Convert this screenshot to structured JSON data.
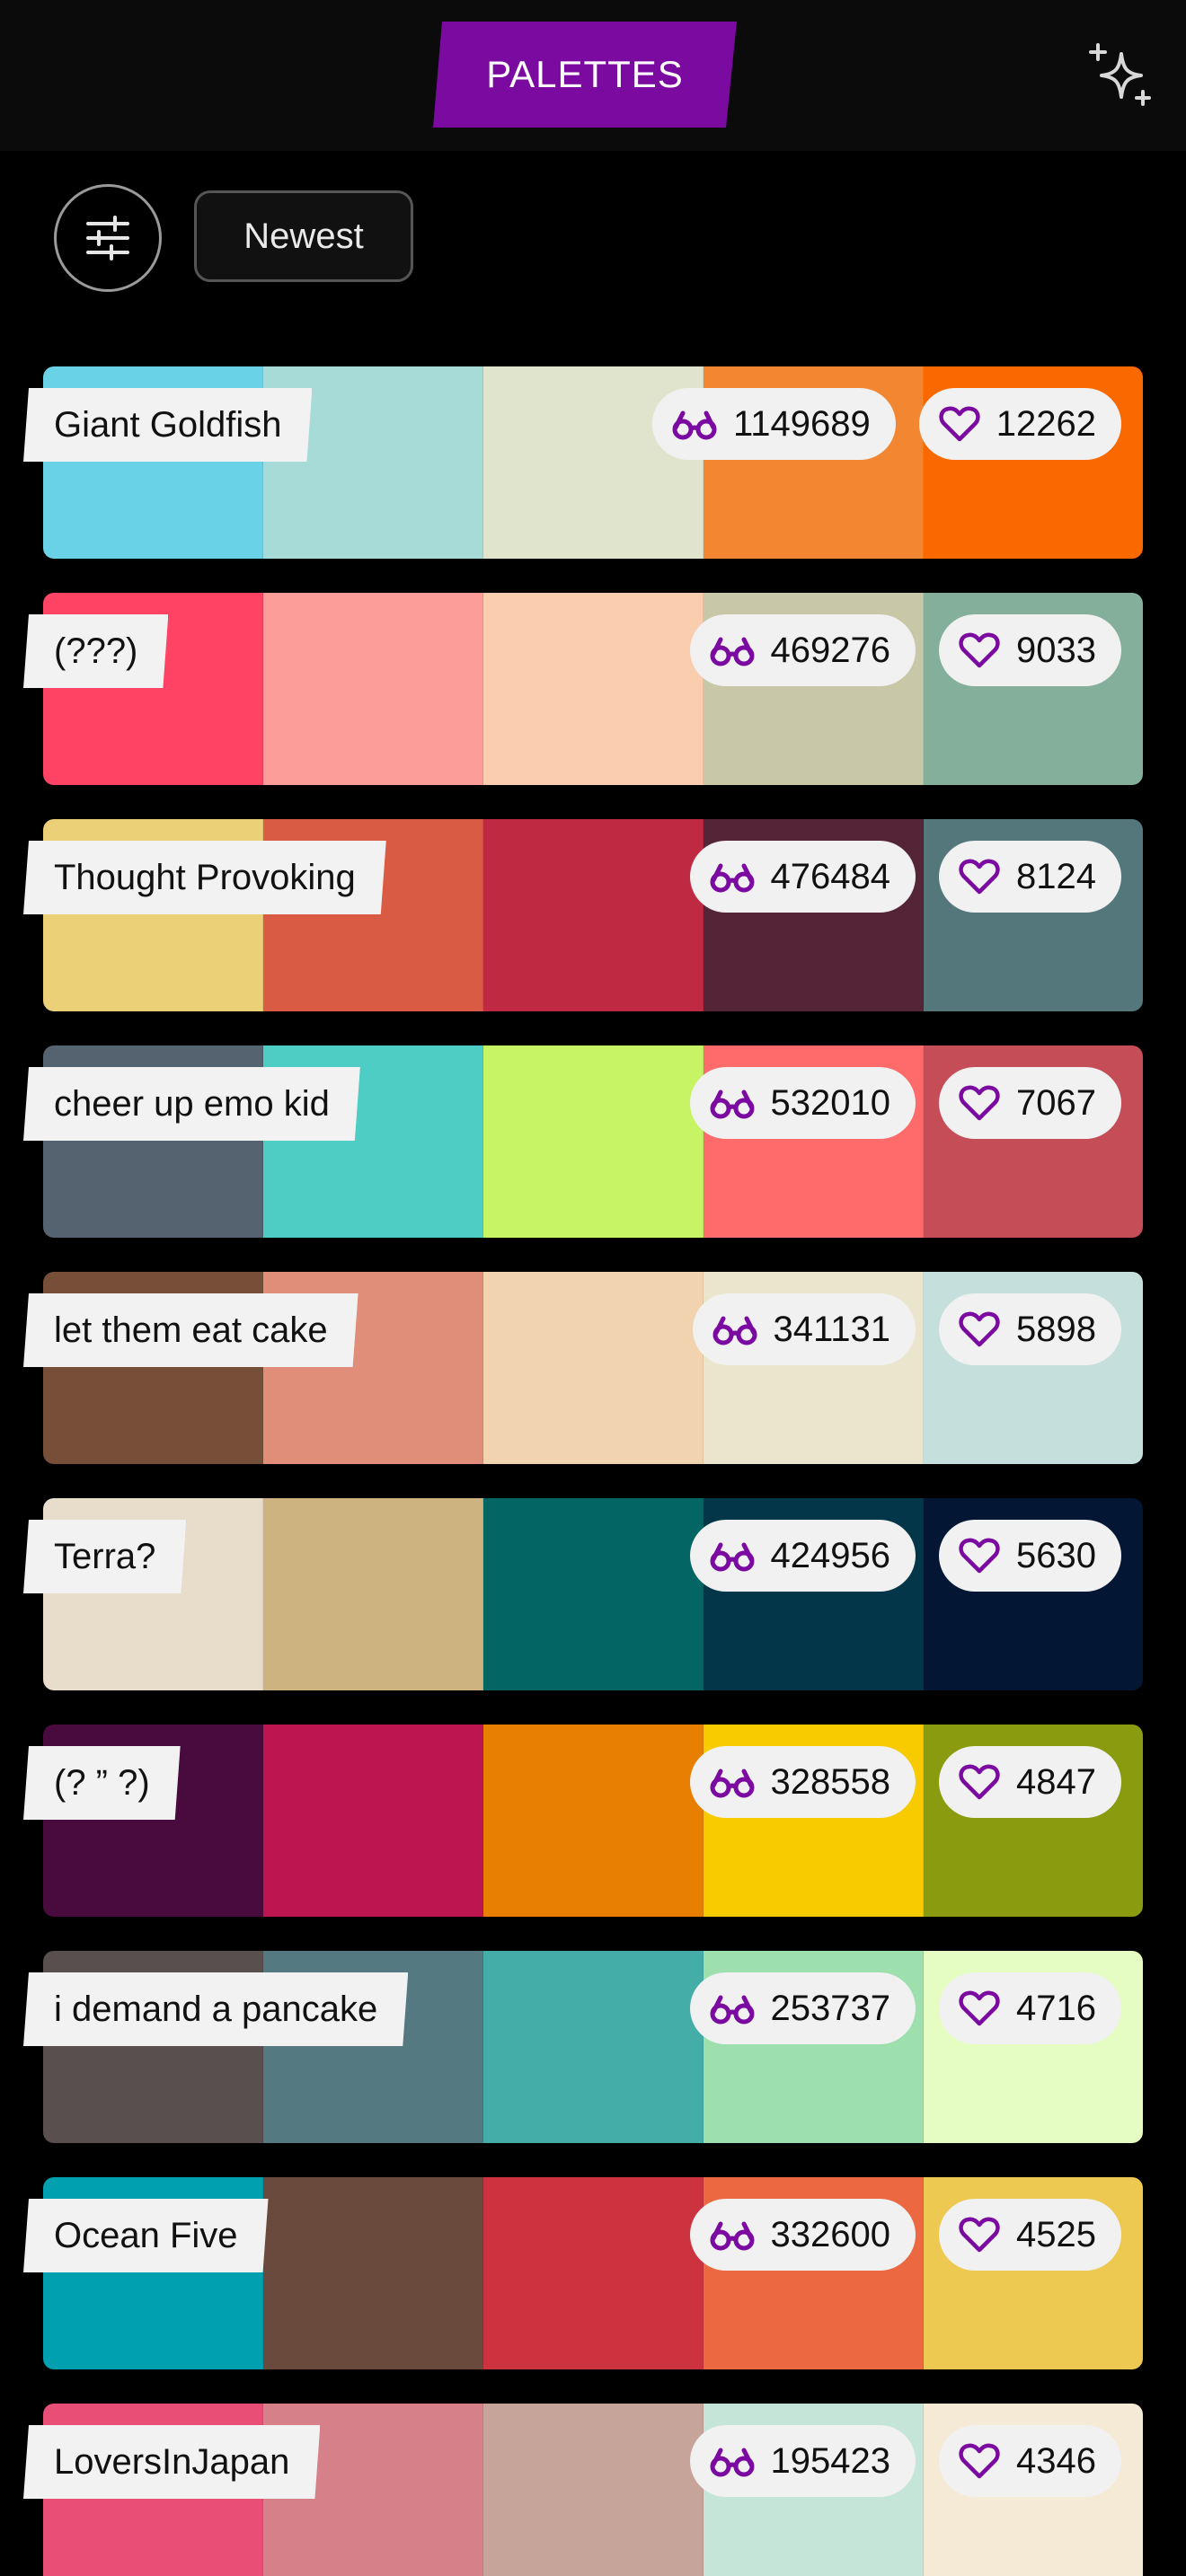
{
  "header": {
    "title": "PALETTES",
    "sparkle_icon": "sparkle-icon"
  },
  "toolbar": {
    "filter_icon": "sliders-icon",
    "sort_label": "Newest"
  },
  "icons": {
    "views": "glasses-icon",
    "likes": "heart-icon"
  },
  "accent_color": "#7a0aa0",
  "palettes": [
    {
      "name": "Giant Goldfish",
      "views": "1149689",
      "likes": "12262",
      "colors": [
        "#69d2e7",
        "#a7dbd8",
        "#e0e4cc",
        "#f38630",
        "#fa6900"
      ]
    },
    {
      "name": "(???)",
      "views": "469276",
      "likes": "9033",
      "colors": [
        "#fe4365",
        "#fc9d9a",
        "#f9cdad",
        "#c8c8a9",
        "#83af9b"
      ]
    },
    {
      "name": "Thought Provoking",
      "views": "476484",
      "likes": "8124",
      "colors": [
        "#ecd078",
        "#d95b43",
        "#c02942",
        "#542437",
        "#53777a"
      ]
    },
    {
      "name": "cheer up emo kid",
      "views": "532010",
      "likes": "7067",
      "colors": [
        "#556270",
        "#4ecdc4",
        "#c7f464",
        "#ff6b6b",
        "#c44d58"
      ]
    },
    {
      "name": "let them eat cake",
      "views": "341131",
      "likes": "5898",
      "colors": [
        "#774f38",
        "#e08e79",
        "#f1d4af",
        "#ece5ce",
        "#c5e0dc"
      ]
    },
    {
      "name": "Terra?",
      "views": "424956",
      "likes": "5630",
      "colors": [
        "#e8ddcb",
        "#cdb380",
        "#036564",
        "#033649",
        "#031634"
      ]
    },
    {
      "name": "(? ” ?)",
      "views": "328558",
      "likes": "4847",
      "colors": [
        "#490a3d",
        "#bd1550",
        "#e97f02",
        "#f8ca00",
        "#8a9b0f"
      ]
    },
    {
      "name": "i demand a pancake",
      "views": "253737",
      "likes": "4716",
      "colors": [
        "#594f4f",
        "#547980",
        "#45ada8",
        "#9de0ad",
        "#e5fcc2"
      ]
    },
    {
      "name": "Ocean Five",
      "views": "332600",
      "likes": "4525",
      "colors": [
        "#00a0b0",
        "#6a4a3c",
        "#cc333f",
        "#eb6841",
        "#edc951"
      ]
    },
    {
      "name": "LoversInJapan",
      "views": "195423",
      "likes": "4346",
      "colors": [
        "#e94e77",
        "#d68189",
        "#c6a49a",
        "#c6e5d9",
        "#f4ead5"
      ]
    }
  ]
}
